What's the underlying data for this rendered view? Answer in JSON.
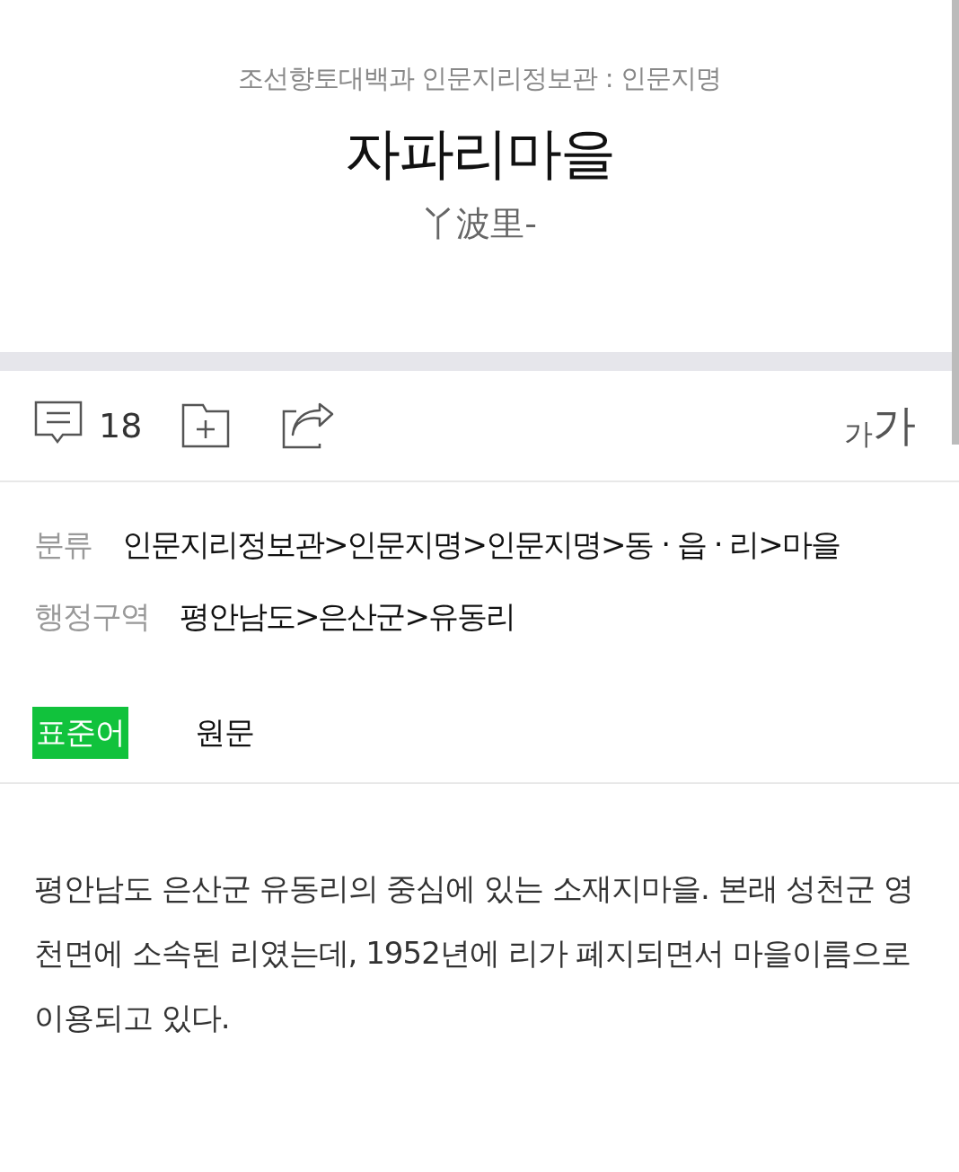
{
  "header": {
    "source": "조선향토대백과 인문지리정보관 : 인문지명",
    "title": "자파리마을",
    "hanja": "丫波里-"
  },
  "toolbar": {
    "comment_count": "18",
    "font_size": {
      "small": "가",
      "large": "가"
    }
  },
  "info": [
    {
      "label": "분류",
      "value": "인문지리정보관>인문지명>인문지명>동 · 읍 · 리>마을"
    },
    {
      "label": "행정구역",
      "value": "평안남도>은산군>유동리"
    }
  ],
  "tabs": [
    {
      "label": "표준어",
      "selected": true
    },
    {
      "label": "원문",
      "selected": false
    }
  ],
  "body": "평안남도 은산군 유동리의 중심에 있는 소재지마을. 본래 성천군 영천면에 소속된 리였는데, 1952년에 리가 폐지되면서 마을이름으로 이용되고 있다."
}
